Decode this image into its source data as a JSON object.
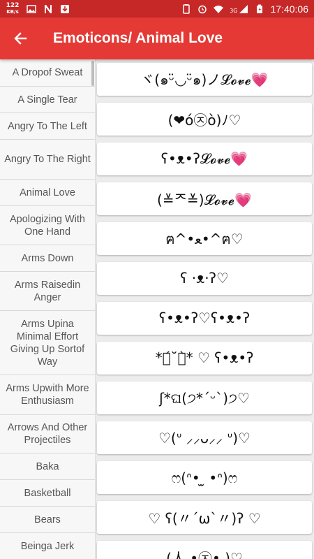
{
  "status_bar": {
    "left": {
      "speed_top": "122",
      "speed_bottom": "KB/s",
      "icons": [
        "image-icon",
        "n-app-icon",
        "download-icon"
      ]
    },
    "right": {
      "icons": [
        "battery-saver-icon",
        "alarm-icon",
        "wifi-icon",
        "signal-icon",
        "battery-icon"
      ],
      "network": "3G",
      "time": "17:40:06"
    }
  },
  "app_bar": {
    "back_icon": "arrow-back-icon",
    "title": "Emoticons/ Animal Love"
  },
  "colors": {
    "app_bar": "#e53935",
    "status_bar": "#c62828",
    "heart": "#e8577e"
  },
  "categories": [
    "A Dropof Sweat",
    "A Single Tear",
    "Angry To The Left",
    "Angry To The Right",
    "Animal Love",
    "Apologizing With One Hand",
    "Arms Down",
    "Arms Raisedin Anger",
    "Arms Upina Minimal Effort Giving Up Sortof Way",
    "Arms Upwith More Enthusiasm",
    "Arrows And Other Projectiles",
    "Baka",
    "Basketball",
    "Bears",
    "Beinga Jerk"
  ],
  "emoticons": [
    "ヾ(๑ᵕ̈◡ᵕ̈๑)ノ𝓛𝓸𝓿𝓮💗",
    "(❤ó㉨ò)ﾉ♡",
    "ʕ•ᴥ•ʔ𝓛𝓸𝓿𝓮💗",
    "(≚ᄌ≚)𝓛𝓸𝓿𝓮💗",
    "ฅ^•ﻌ•^ฅ♡",
    "ʕ ·ᴥ·ʔ♡",
    "ʕ•ᴥ•ʔ♡ʕ•ᴥ•ʔ",
    "*ฅ́˘ฅ̀* ♡ ʕ•ᴥ•ʔ",
    "ʃ*ଘ(੭*ˊᵕˋ)੭♡",
    "♡(ᐡ ⸝⸝ᴗ⸝⸝ ᐡ)♡",
    "ෆ(ᐢ• ̫ •ᐢ)ෆ",
    "♡ ʕ(〃´ω`〃)ʔ ♡",
    "(人 •㉨• )♡"
  ]
}
